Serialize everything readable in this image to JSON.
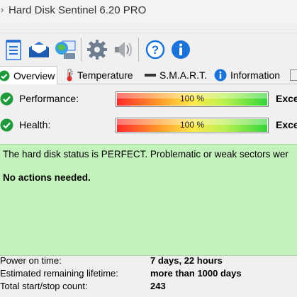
{
  "window": {
    "title": "Hard Disk Sentinel 6.20 PRO"
  },
  "toolbar": {
    "buttons": [
      {
        "icon": "report-icon"
      },
      {
        "icon": "email-icon"
      },
      {
        "icon": "network-icon"
      },
      {
        "icon": "settings-gear-icon"
      },
      {
        "icon": "sound-icon"
      },
      {
        "icon": "help-icon"
      },
      {
        "icon": "info-icon"
      }
    ]
  },
  "tabs": [
    {
      "label": "Overview",
      "icon": "check-icon",
      "active": true
    },
    {
      "label": "Temperature",
      "icon": "thermometer-icon"
    },
    {
      "label": "S.M.A.R.T.",
      "icon": "dash-icon"
    },
    {
      "label": "Information",
      "icon": "info-icon"
    }
  ],
  "metrics": {
    "performance": {
      "label": "Performance:",
      "value_text": "100 %",
      "value": 1.0,
      "status": "Exce"
    },
    "health": {
      "label": "Health:",
      "value_text": "100 %",
      "value": 1.0,
      "status": "Exce"
    }
  },
  "status": {
    "text": "The hard disk status is PERFECT. Problematic or weak sectors wer",
    "action": "No actions needed.",
    "color": "#c4f2bd"
  },
  "info": [
    {
      "label": "Power on time:",
      "value": "7 days, 22 hours"
    },
    {
      "label": "Estimated remaining lifetime:",
      "value": "more than 1000 days"
    },
    {
      "label": "Total start/stop count:",
      "value": "243"
    }
  ],
  "colors": {
    "check_green": "#1f9a3a",
    "info_blue": "#1a73d9"
  }
}
